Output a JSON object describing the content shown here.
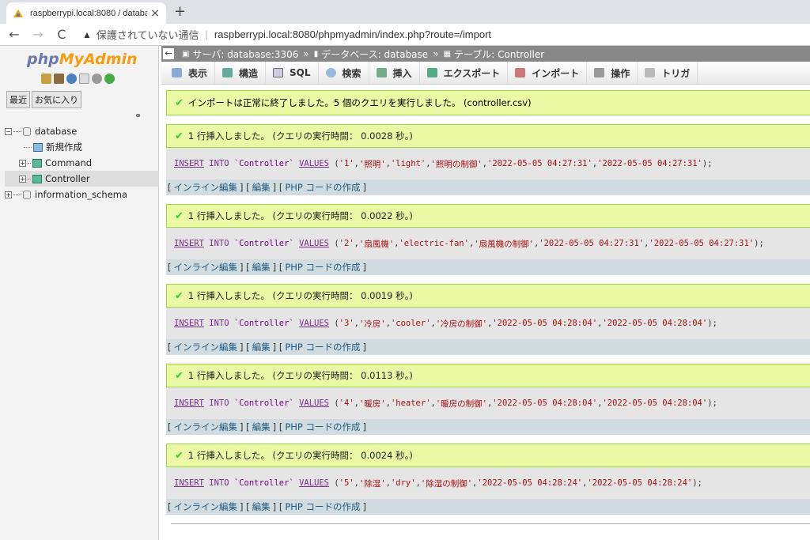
{
  "browser": {
    "tab_title": "raspberrypi.local:8080 / database",
    "tab_close": "×",
    "new_tab": "+",
    "back": "←",
    "forward": "→",
    "reload": "C",
    "insecure_label": "保護されていない通信",
    "url_sep": "|",
    "url": "raspberrypi.local:8080/phpmyadmin/index.php?route=/import"
  },
  "sidebar": {
    "logo_php": "php",
    "logo_myadmin": "MyAdmin",
    "tab_recent": "最近",
    "tab_favorites": "お気に入り",
    "tree": {
      "database": "database",
      "new": "新規作成",
      "command": "Command",
      "controller": "Controller",
      "information_schema": "information_schema"
    }
  },
  "breadcrumb": {
    "back": "←",
    "server": "サーバ: database:3306",
    "database": "データベース: database",
    "table": "テーブル: Controller",
    "arrow": "»"
  },
  "menu": {
    "browse": "表示",
    "structure": "構造",
    "sql": "SQL",
    "search": "検索",
    "insert": "挿入",
    "export": "エクスポート",
    "import": "インポート",
    "operations": "操作",
    "triggers": "トリガ"
  },
  "import_message": "インポートは正常に終了しました。5 個のクエリを実行しました。 (controller.csv)",
  "links": {
    "inline_edit": "インライン編集",
    "edit": "編集",
    "php_code": "PHP コードの作成",
    "open": "[",
    "close": "]"
  },
  "sql_parts": {
    "insert": "INSERT",
    "into": "INTO",
    "table": "`Controller`",
    "values": "VALUES"
  },
  "results": [
    {
      "message": "1 行挿入しました。 (クエリの実行時間： 0.0028 秒。)",
      "v1": "'1'",
      "v2": "'照明'",
      "v3": "'light'",
      "v4": "'照明の制御'",
      "v5": "'2022-05-05 04:27:31'",
      "v6": "'2022-05-05 04:27:31'"
    },
    {
      "message": "1 行挿入しました。 (クエリの実行時間： 0.0022 秒。)",
      "v1": "'2'",
      "v2": "'扇風機'",
      "v3": "'electric-fan'",
      "v4": "'扇風機の制御'",
      "v5": "'2022-05-05 04:27:31'",
      "v6": "'2022-05-05 04:27:31'"
    },
    {
      "message": "1 行挿入しました。 (クエリの実行時間： 0.0019 秒。)",
      "v1": "'3'",
      "v2": "'冷房'",
      "v3": "'cooler'",
      "v4": "'冷房の制御'",
      "v5": "'2022-05-05 04:28:04'",
      "v6": "'2022-05-05 04:28:04'"
    },
    {
      "message": "1 行挿入しました。 (クエリの実行時間： 0.0113 秒。)",
      "v1": "'4'",
      "v2": "'暖房'",
      "v3": "'heater'",
      "v4": "'暖房の制御'",
      "v5": "'2022-05-05 04:28:04'",
      "v6": "'2022-05-05 04:28:04'"
    },
    {
      "message": "1 行挿入しました。 (クエリの実行時間： 0.0024 秒。)",
      "v1": "'5'",
      "v2": "'除湿'",
      "v3": "'dry'",
      "v4": "'除湿の制御'",
      "v5": "'2022-05-05 04:28:24'",
      "v6": "'2022-05-05 04:28:24'"
    }
  ]
}
